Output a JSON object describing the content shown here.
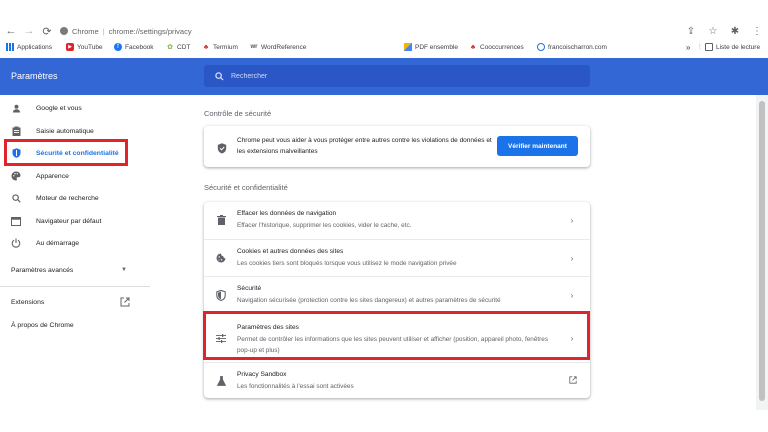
{
  "browser": {
    "chrome_label": "Chrome",
    "url": "chrome://settings/privacy",
    "bookmarks": [
      {
        "label": "Applications",
        "icon": "apps-grid-icon"
      },
      {
        "label": "YouTube",
        "icon": "youtube-icon"
      },
      {
        "label": "Facebook",
        "icon": "facebook-icon"
      },
      {
        "label": "CDT",
        "icon": "cdt-icon"
      },
      {
        "label": "Termium",
        "icon": "maple-leaf-icon"
      },
      {
        "label": "WordReference",
        "icon": "wordreference-icon"
      },
      {
        "label": "PDF ensemble",
        "icon": "pdf-ensemble-icon"
      },
      {
        "label": "Cooccurrences",
        "icon": "maple-leaf-icon"
      },
      {
        "label": "francoischarron.com",
        "icon": "charron-icon"
      }
    ],
    "more_bookmarks": "»",
    "reading_list": "Liste de lecture"
  },
  "header": {
    "title": "Paramètres",
    "search_placeholder": "Rechercher"
  },
  "sidebar": {
    "items": [
      {
        "label": "Google et vous",
        "icon": "person-icon"
      },
      {
        "label": "Saisie automatique",
        "icon": "clipboard-icon"
      },
      {
        "label": "Sécurité et confidentialité",
        "icon": "shield-icon"
      },
      {
        "label": "Apparence",
        "icon": "palette-icon"
      },
      {
        "label": "Moteur de recherche",
        "icon": "search-icon"
      },
      {
        "label": "Navigateur par défaut",
        "icon": "browser-icon"
      },
      {
        "label": "Au démarrage",
        "icon": "power-icon"
      }
    ],
    "advanced": "Paramètres avancés",
    "extensions": "Extensions",
    "about": "À propos de Chrome"
  },
  "safety_check": {
    "section_title": "Contrôle de sécurité",
    "text": "Chrome peut vous aider à vous protéger entre autres contre les violations de données et les extensions malveillantes",
    "button": "Vérifier maintenant"
  },
  "privacy": {
    "section_title": "Sécurité et confidentialité",
    "rows": [
      {
        "title": "Effacer les données de navigation",
        "desc": "Effacer l'historique, supprimer les cookies, vider le cache, etc.",
        "icon": "trash-icon"
      },
      {
        "title": "Cookies et autres données des sites",
        "desc": "Les cookies tiers sont bloqués lorsque vous utilisez le mode navigation privée",
        "icon": "cookie-icon"
      },
      {
        "title": "Sécurité",
        "desc": "Navigation sécurisée (protection contre les sites dangereux) et autres paramètres de sécurité",
        "icon": "shield-icon"
      },
      {
        "title": "Paramètres des sites",
        "desc": "Permet de contrôler les informations que les sites peuvent utiliser et afficher (position, appareil photo, fenêtres pop-up et plus)",
        "icon": "sliders-icon"
      },
      {
        "title": "Privacy Sandbox",
        "desc": "Les fonctionnalités à l'essai sont activées",
        "icon": "flask-icon"
      }
    ]
  },
  "colors": {
    "header_blue": "#3367d6",
    "accent": "#1a73e8",
    "highlight_red": "#e0242b"
  }
}
